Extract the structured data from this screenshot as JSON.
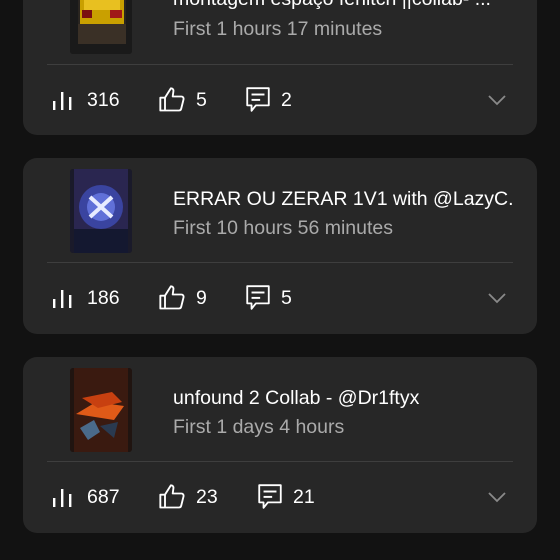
{
  "videos": [
    {
      "title": "montagem espaço fenitch ||collab- ...",
      "subtitle": "First 1 hours 17 minutes",
      "views": "316",
      "likes": "5",
      "comments": "2"
    },
    {
      "title": "ERRAR OU ZERAR 1V1 with @LazyC...",
      "subtitle": "First 10 hours 56 minutes",
      "views": "186",
      "likes": "9",
      "comments": "5"
    },
    {
      "title": "unfound 2 Collab - @Dr1ftyx",
      "subtitle": "First 1 days 4 hours",
      "views": "687",
      "likes": "23",
      "comments": "21"
    }
  ],
  "icons": {
    "views": "bar-chart-icon",
    "likes": "thumbs-up-icon",
    "comments": "comment-icon",
    "expand": "chevron-down-icon"
  },
  "colors": {
    "background": "#121212",
    "card": "#272727",
    "secondary_text": "#aaaaaa"
  }
}
